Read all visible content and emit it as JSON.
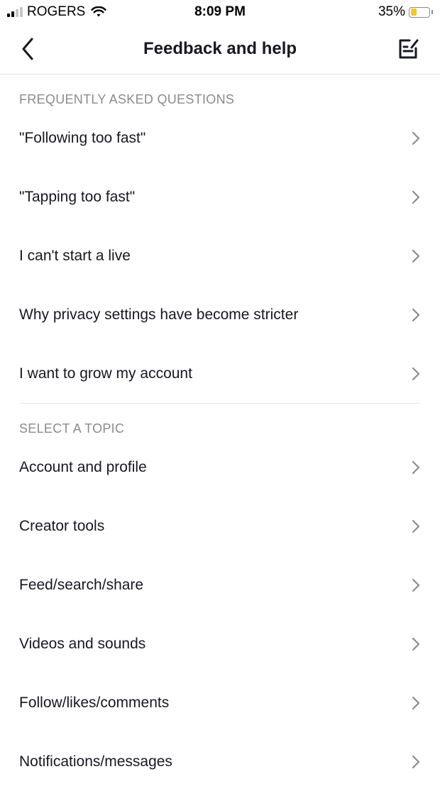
{
  "status_bar": {
    "carrier": "ROGERS",
    "time": "8:09 PM",
    "battery_percent": "35%",
    "battery_level": 0.35,
    "signal_bars": 2,
    "signal_total": 4,
    "battery_color": "#f7c52b"
  },
  "header": {
    "title": "Feedback and help",
    "back_icon": "chevron-left-icon",
    "report_icon": "report-edit-icon"
  },
  "faq": {
    "heading": "FREQUENTLY ASKED QUESTIONS",
    "items": [
      {
        "label": "\"Following too fast\""
      },
      {
        "label": "\"Tapping too fast\""
      },
      {
        "label": "I can't start a live"
      },
      {
        "label": "Why privacy settings have become stricter"
      },
      {
        "label": "I want to grow my account"
      }
    ]
  },
  "topics": {
    "heading": "SELECT A TOPIC",
    "items": [
      {
        "label": "Account and profile"
      },
      {
        "label": "Creator tools"
      },
      {
        "label": "Feed/search/share"
      },
      {
        "label": "Videos and sounds"
      },
      {
        "label": "Follow/likes/comments"
      },
      {
        "label": "Notifications/messages"
      }
    ]
  },
  "colors": {
    "text_primary": "#161823",
    "text_secondary": "#8a8b91",
    "chevron": "#8a8b91",
    "divider": "#e8e8ea"
  }
}
